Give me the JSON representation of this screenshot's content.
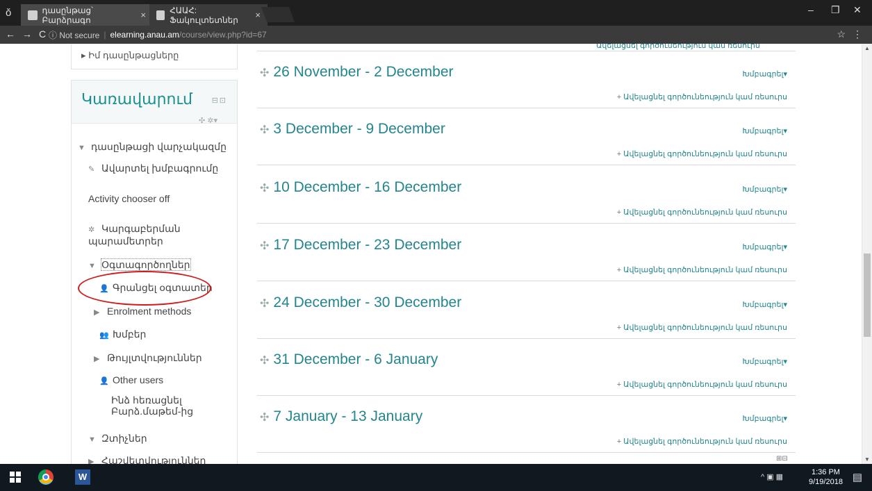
{
  "browser": {
    "incognito_icon": "incognito-icon",
    "tabs": [
      {
        "label": "դասընթաց՝ Բարձրագո",
        "close": "×"
      },
      {
        "label": "ՀԱԱՀ: Ֆակուլտետներ",
        "close": "×"
      }
    ],
    "window_controls": {
      "minimize": "–",
      "maximize": "❐",
      "close": "✕"
    },
    "nav": {
      "back": "←",
      "forward": "→",
      "reload": "C"
    },
    "url": {
      "security": "ⓘ Not secure",
      "host": "elearning.anau.am",
      "path": "/course/view.php?id=67"
    },
    "star": "☆",
    "menu": "⋮"
  },
  "sidebar": {
    "my_courses": "Իմ դասընթացները",
    "admin_title": "Կառավարում",
    "admin_controls": "⊟⊡",
    "admin_tools": "✣ ✲▾",
    "items": [
      {
        "label": "դասընթացի վարչակազմը",
        "icon": "▼"
      },
      {
        "label": "Ավարտել խմբագրումը",
        "icon": "✎"
      },
      {
        "label": "Activity chooser off",
        "icon": ""
      },
      {
        "label": "Կարգաբերման պարամետրեր",
        "icon": "✲"
      },
      {
        "label": "Օգտագործողներ",
        "icon": "▼"
      },
      {
        "label": "Գրանցել օգտատեր",
        "icon": "👤"
      },
      {
        "label": "Enrolment methods",
        "icon": "▶"
      },
      {
        "label": "Խմբեր",
        "icon": "👥"
      },
      {
        "label": "Թույլտվություններ",
        "icon": "▶"
      },
      {
        "label": "Other users",
        "icon": "👤"
      },
      {
        "label": "Ինձ հեռացնել Բարձ.մաթեմ-ից",
        "icon": ""
      },
      {
        "label": "Զտիչներ",
        "icon": "▼"
      },
      {
        "label": "Հաշվետվություններ",
        "icon": "▶"
      }
    ]
  },
  "main": {
    "top_add": "Ավելացնել գործունեություն կամ ռեսուրս",
    "edit_label": "Խմբագրել",
    "add_label": "Ավելացնել գործունեություն կամ ռեսուրս",
    "sections": [
      {
        "title": "26 November - 2 December"
      },
      {
        "title": "3 December - 9 December"
      },
      {
        "title": "10 December - 16 December"
      },
      {
        "title": "17 December - 23 December"
      },
      {
        "title": "24 December - 30 December"
      },
      {
        "title": "31 December - 6 January"
      },
      {
        "title": "7 January - 13 January"
      }
    ],
    "bottom_icons": "⊞⊟"
  },
  "taskbar": {
    "word_label": "W",
    "tray": "^ ▣ ▦",
    "time": "1:36 PM",
    "date": "9/19/2018",
    "notifications": "▤"
  },
  "colors": {
    "link": "#23858d",
    "highlight": "#d11a1a",
    "title": "#1a8f8f"
  }
}
